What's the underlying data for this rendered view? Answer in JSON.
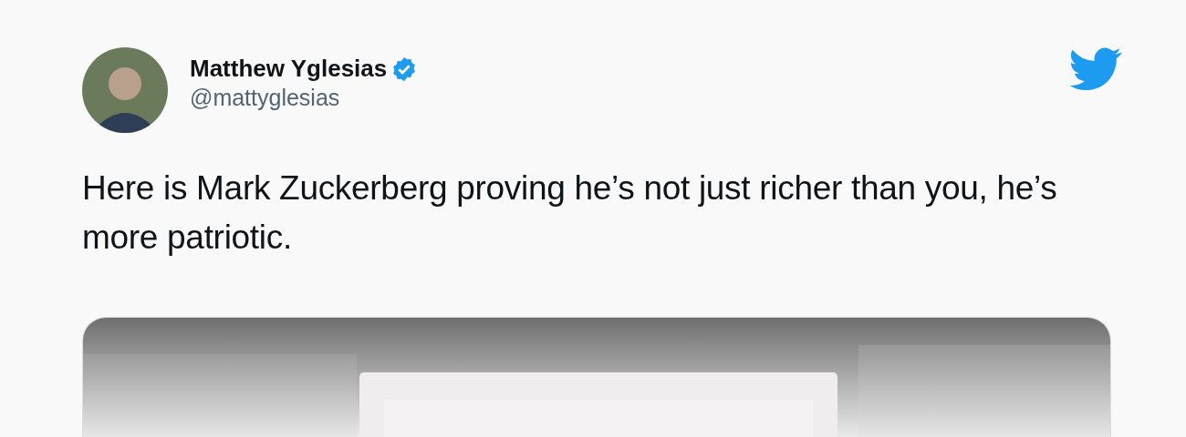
{
  "author": {
    "name": "Matthew Yglesias",
    "handle": "@mattyglesias",
    "verified": true
  },
  "tweet": {
    "text": "Here is Mark Zuckerberg proving he’s not just richer than you, he’s more patriotic."
  }
}
